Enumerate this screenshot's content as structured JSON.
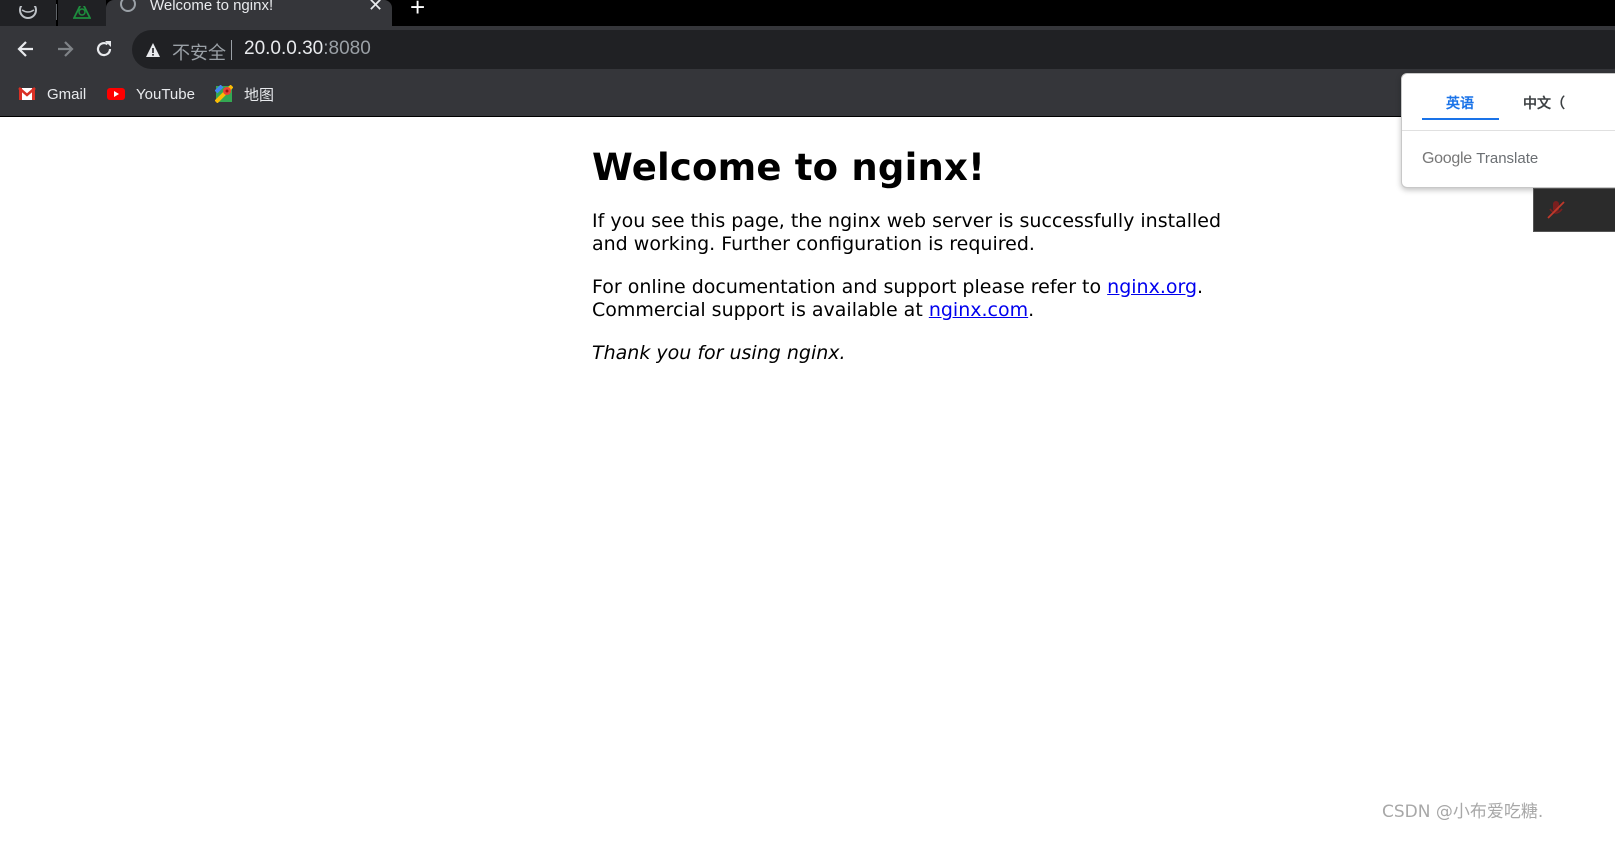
{
  "tabs": {
    "active_title": "Welcome to nginx!",
    "close_glyph": "✕",
    "new_tab_glyph": "+"
  },
  "toolbar": {
    "security_label": "不安全",
    "url_host": "20.0.0.30",
    "url_port": ":8080"
  },
  "bookmarks": [
    {
      "label": "Gmail",
      "icon": "gmail-icon"
    },
    {
      "label": "YouTube",
      "icon": "youtube-icon"
    },
    {
      "label": "地图",
      "icon": "maps-icon"
    }
  ],
  "page": {
    "heading": "Welcome to nginx!",
    "p1": "If you see this page, the nginx web server is successfully installed and working. Further configuration is required.",
    "p2_prefix": "For online documentation and support please refer to ",
    "p2_link1": "nginx.org",
    "p2_mid": ".",
    "p2_line2": "Commercial support is available at ",
    "p2_link2": "nginx.com",
    "p2_end": ".",
    "p3": "Thank you for using nginx."
  },
  "translate": {
    "source_lang": "英语",
    "target_lang": "中文（",
    "brand_google": "Google",
    "brand_translate": "Translate"
  },
  "watermark": "CSDN @小布爱吃糖.",
  "colors": {
    "tab_bg": "#35363a",
    "omnibox_bg": "#202124",
    "link": "#0000ee",
    "translate_accent": "#1a73e8"
  }
}
